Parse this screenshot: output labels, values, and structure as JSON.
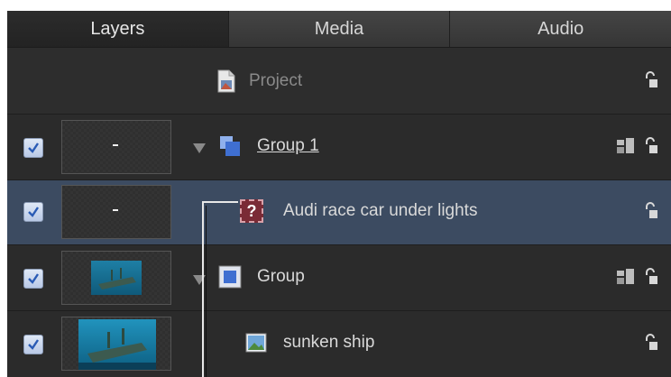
{
  "tabs": [
    {
      "label": "Layers",
      "active": true
    },
    {
      "label": "Media",
      "active": false
    },
    {
      "label": "Audio",
      "active": false
    }
  ],
  "rows": {
    "project": {
      "label": "Project",
      "icon": "project-file-icon"
    },
    "group1": {
      "label": "Group 1",
      "checked": true,
      "expanded": true,
      "thumbnail": "-",
      "icon": "group-layer-icon"
    },
    "audi": {
      "label": "Audi race car under lights",
      "checked": true,
      "thumbnail": "-",
      "icon": "missing-media-icon",
      "icon_glyph": "?",
      "selected": true
    },
    "group": {
      "label": "Group",
      "checked": true,
      "expanded": true,
      "icon": "group-layer-icon"
    },
    "ship": {
      "label": "sunken ship",
      "checked": true,
      "icon": "image-layer-icon"
    }
  },
  "colors": {
    "panel": "#2a2a2a",
    "selected_row": "#3c4b61",
    "text": "#d9d9d9",
    "dim_text": "#8a8a8a",
    "checkbox": "#c9d6ee"
  }
}
